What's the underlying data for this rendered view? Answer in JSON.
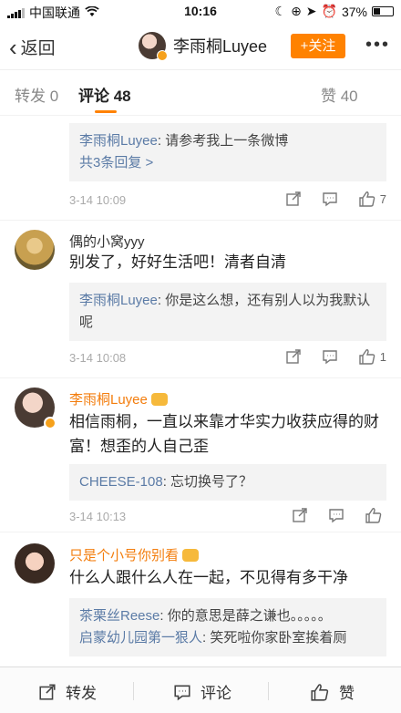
{
  "status": {
    "carrier": "中国联通",
    "time": "10:16",
    "battery": "37%"
  },
  "nav": {
    "back_label": "返回",
    "title": "李雨桐Luyee",
    "follow_label": "+关注",
    "more_label": "•••"
  },
  "tabs": {
    "repost": "转发 0",
    "comments": "评论 48",
    "likes": "赞 40"
  },
  "comments": [
    {
      "reply_name": "李雨桐Luyee",
      "reply_text": ": 请参考我上一条微博",
      "more_replies": "共3条回复 >",
      "time": "3-14 10:09",
      "likes": "7"
    },
    {
      "name": "偶的小窝yyy",
      "text": "别发了，好好生活吧！清者自清",
      "reply_name": "李雨桐Luyee",
      "reply_text": ": 你是这么想，还有别人以为我默认呢",
      "time": "3-14 10:08",
      "likes": "1"
    },
    {
      "name": "李雨桐Luyee",
      "text": "相信雨桐，一直以来靠才华实力收获应得的财富！想歪的人自己歪",
      "reply_name": "CHEESE-108",
      "reply_text": ": 忘切换号了？",
      "time": "3-14 10:13",
      "likes": ""
    },
    {
      "name": "只是个小号你别看",
      "text": "什么人跟什么人在一起，不见得有多干净",
      "reply_name": "茶栗丝Reese",
      "reply_text": ": 你的意思是薛之谦也。。。。。",
      "reply2_name": "启蒙幼儿园第一狠人",
      "reply2_text": ": 笑死啦你家卧室挨着厕"
    }
  ],
  "bottom": {
    "repost": "转发",
    "comment": "评论",
    "like": "赞"
  },
  "colors": {
    "accent": "#ff8200",
    "link": "#5b7ba6",
    "name_orange": "#f37d0d"
  }
}
